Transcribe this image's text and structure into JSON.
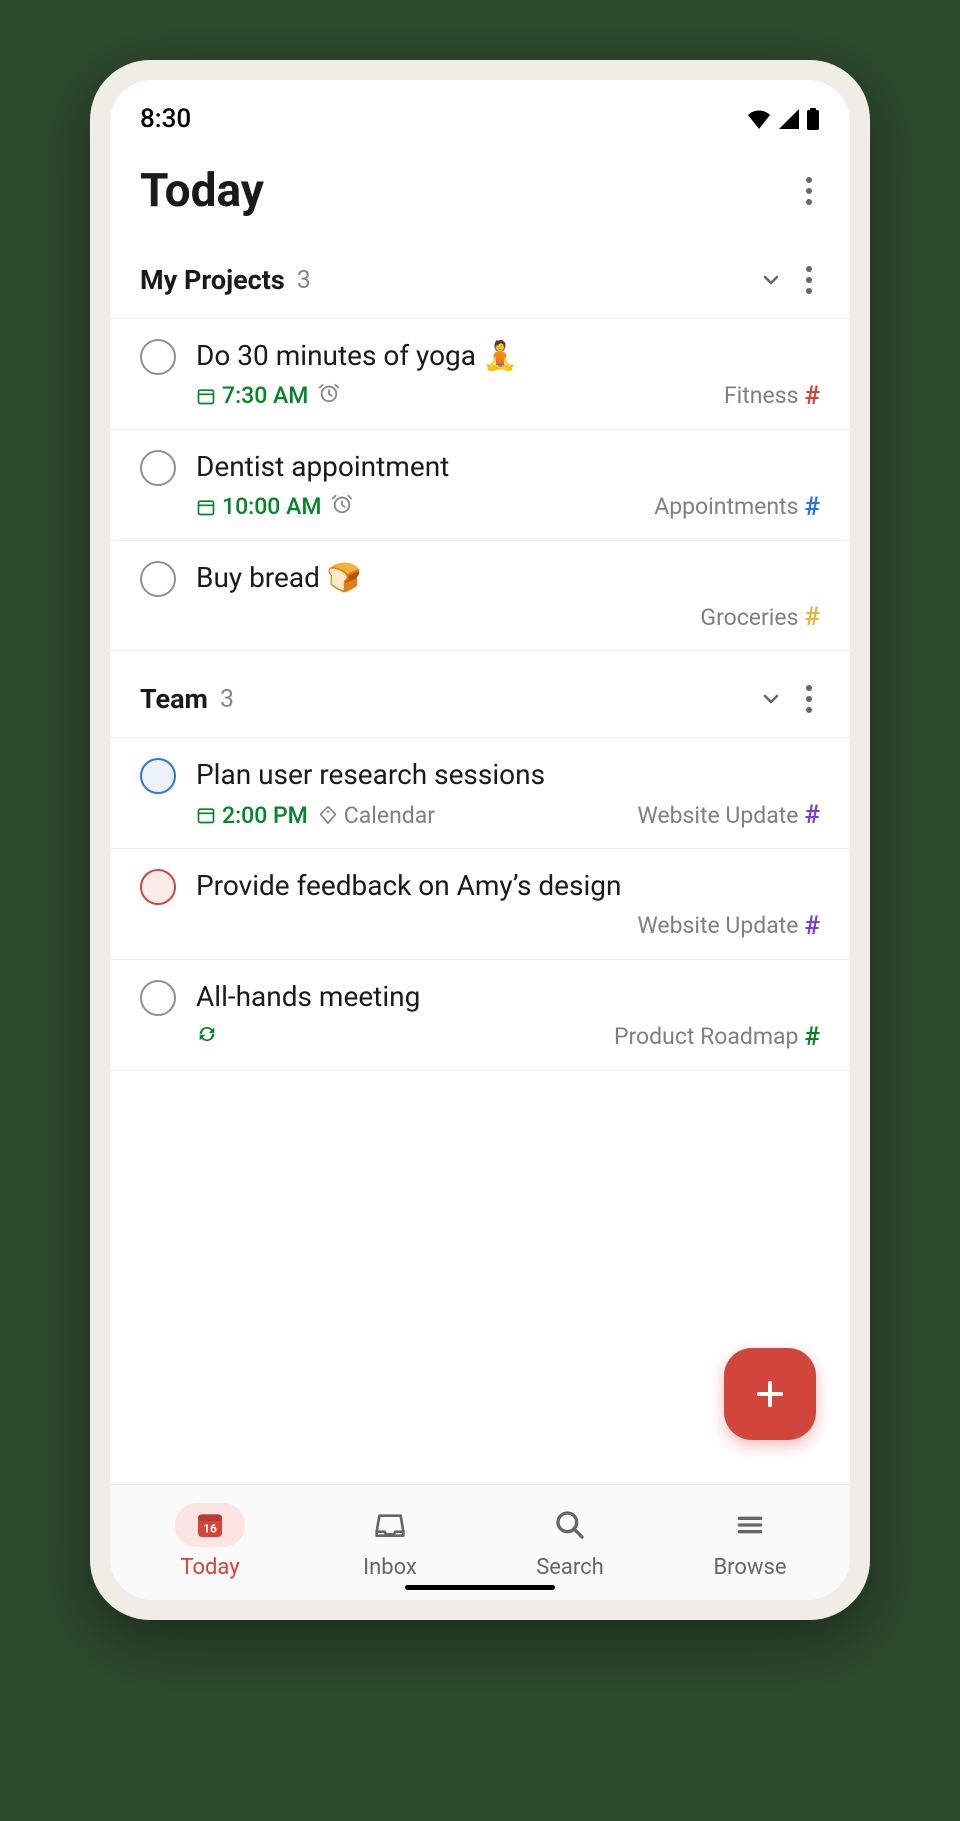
{
  "status": {
    "time": "8:30"
  },
  "header": {
    "title": "Today"
  },
  "sections": [
    {
      "title": "My Projects",
      "count": "3",
      "tasks": [
        {
          "title": "Do 30 minutes of yoga 🧘",
          "time": "7:30 AM",
          "alarm": true,
          "project": "Fitness",
          "hashColor": "red",
          "checkbox": "grey"
        },
        {
          "title": "Dentist appointment",
          "time": "10:00 AM",
          "alarm": true,
          "project": "Appointments",
          "hashColor": "blue",
          "checkbox": "grey"
        },
        {
          "title": "Buy bread 🍞",
          "project": "Groceries",
          "hashColor": "yellow",
          "checkbox": "grey"
        }
      ]
    },
    {
      "title": "Team",
      "count": "3",
      "tasks": [
        {
          "title": "Plan user research sessions",
          "time": "2:00 PM",
          "label": "Calendar",
          "project": "Website Update",
          "hashColor": "purple",
          "checkbox": "blue"
        },
        {
          "title": "Provide feedback on Amy’s design",
          "project": "Website Update",
          "hashColor": "purple",
          "checkbox": "red"
        },
        {
          "title": "All-hands meeting",
          "recurring": true,
          "project": "Product Roadmap",
          "hashColor": "green",
          "checkbox": "grey"
        }
      ]
    }
  ],
  "nav": {
    "items": [
      {
        "label": "Today",
        "icon": "calendar",
        "active": true
      },
      {
        "label": "Inbox",
        "icon": "inbox"
      },
      {
        "label": "Search",
        "icon": "search"
      },
      {
        "label": "Browse",
        "icon": "menu"
      }
    ],
    "today_date": "16"
  }
}
